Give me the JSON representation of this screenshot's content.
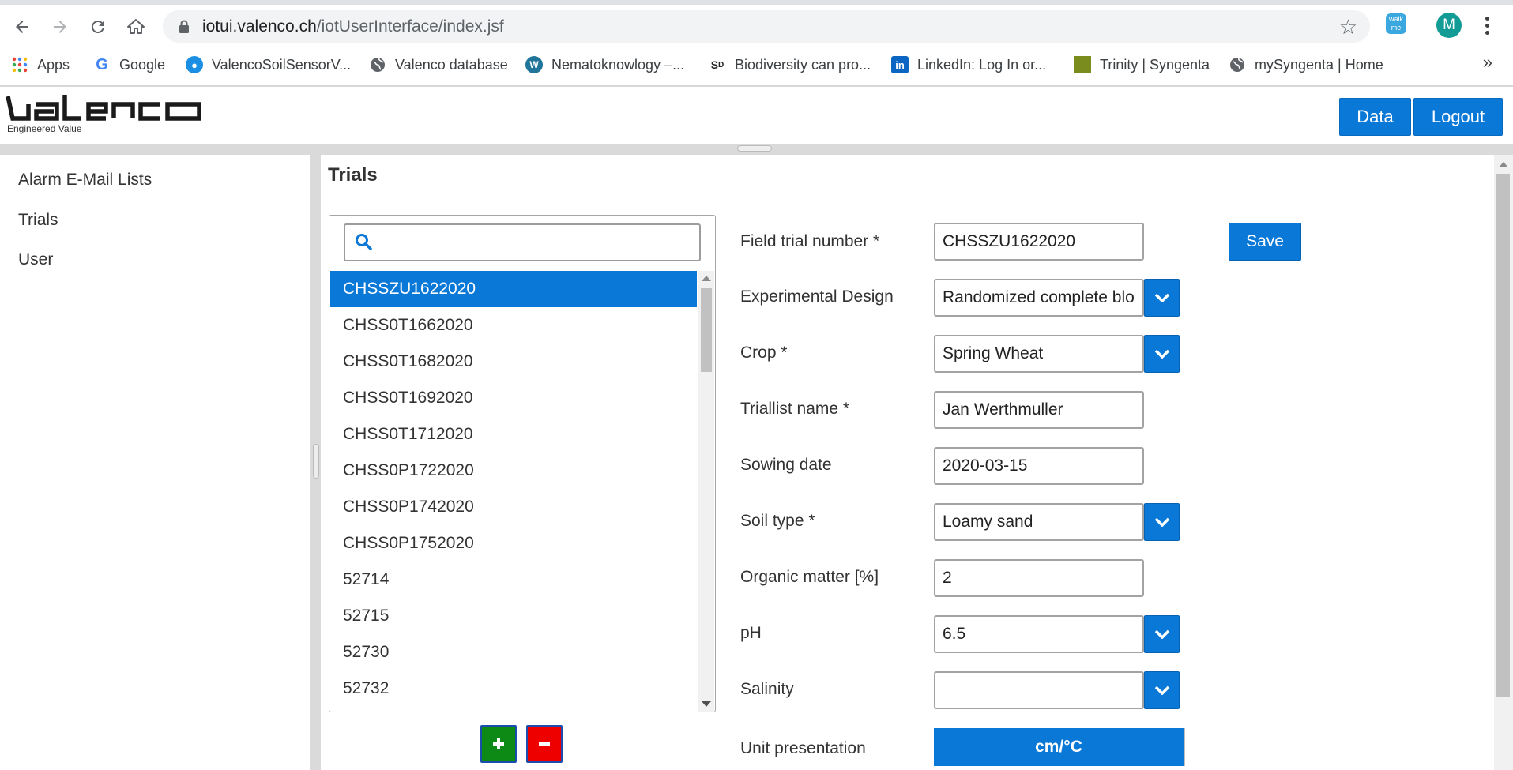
{
  "browser": {
    "url_host": "iotui.valenco.ch",
    "url_path": "/iotUserInterface/index.jsf",
    "extension_label": "walk me",
    "profile_initial": "M",
    "bookmarks": [
      {
        "label": "Apps",
        "icon": "apps-grid-icon"
      },
      {
        "label": "Google",
        "icon": "google-icon"
      },
      {
        "label": "ValencoSoilSensorV...",
        "icon": "lightbulb-icon"
      },
      {
        "label": "Valenco database",
        "icon": "globe-icon"
      },
      {
        "label": "Nematoknowlogy –...",
        "icon": "wordpress-icon"
      },
      {
        "label": "Biodiversity can pro...",
        "icon": "sd-icon"
      },
      {
        "label": "LinkedIn: Log In or...",
        "icon": "linkedin-icon"
      },
      {
        "label": "Trinity | Syngenta",
        "icon": "syngenta-icon"
      },
      {
        "label": "mySyngenta | Home",
        "icon": "globe-icon"
      }
    ],
    "more_label": "»"
  },
  "header": {
    "logo_text": "valenco",
    "tagline": "Engineered Value",
    "data_label": "Data",
    "logout_label": "Logout"
  },
  "sidebar": {
    "items": [
      {
        "label": "Alarm E-Mail Lists"
      },
      {
        "label": "Trials"
      },
      {
        "label": "User"
      }
    ]
  },
  "main": {
    "title": "Trials",
    "search": {
      "value": "",
      "placeholder": ""
    },
    "trials": [
      "CHSSZU1622020",
      "CHSS0T1662020",
      "CHSS0T1682020",
      "CHSS0T1692020",
      "CHSS0T1712020",
      "CHSS0P1722020",
      "CHSS0P1742020",
      "CHSS0P1752020",
      "52714",
      "52715",
      "52730",
      "52732"
    ],
    "selected_trial": "CHSSZU1622020",
    "add_label": "+",
    "remove_label": "−"
  },
  "form": {
    "field_trial_number": {
      "label": "Field trial number  *",
      "value": "CHSSZU1622020"
    },
    "experimental_design": {
      "label": "Experimental Design",
      "value": "Randomized complete blo"
    },
    "crop": {
      "label": "Crop *",
      "value": "Spring Wheat"
    },
    "triallist_name": {
      "label": "Triallist name  *",
      "value": "Jan Werthmuller"
    },
    "sowing_date": {
      "label": "Sowing date",
      "value": "2020-03-15"
    },
    "soil_type": {
      "label": "Soil type *",
      "value": "Loamy sand"
    },
    "organic_matter": {
      "label": "Organic matter [%]",
      "value": "2"
    },
    "ph": {
      "label": "pH",
      "value": "6.5"
    },
    "salinity": {
      "label": "Salinity",
      "value": ""
    },
    "unit_presentation": {
      "label": "Unit presentation",
      "value": "cm/°C"
    },
    "save_label": "Save"
  },
  "colors": {
    "accent": "#0a78d7",
    "add": "#0d8a16",
    "remove": "#ee0000"
  }
}
